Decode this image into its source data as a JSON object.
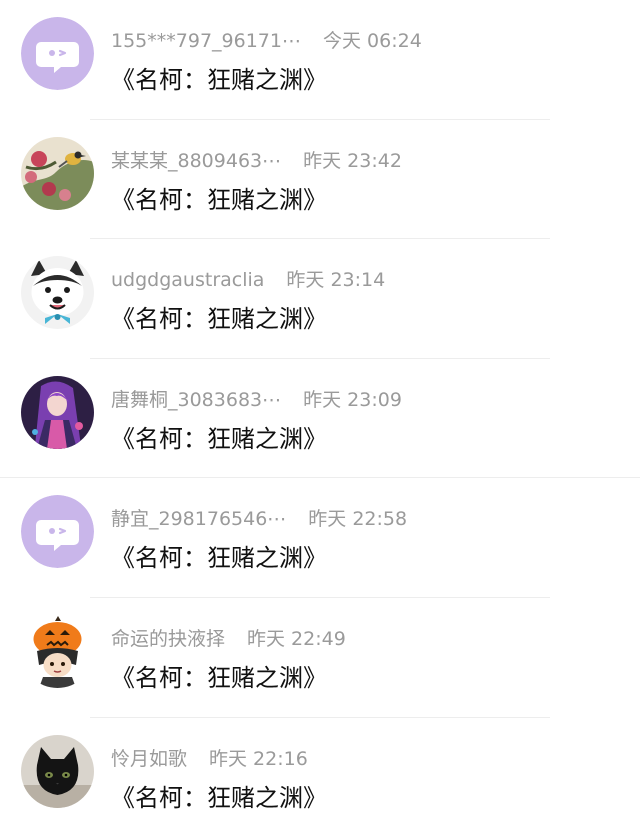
{
  "messages": [
    {
      "name": "155***797_96171⋯",
      "time": "今天 06:24",
      "text": "《名柯：狂赌之渊》",
      "avatar": "chat-bubble-icon"
    },
    {
      "name": "某某某_8809463⋯",
      "time": "昨天 23:42",
      "text": "《名柯：狂赌之渊》",
      "avatar": "bird-flower-painting"
    },
    {
      "name": "udgdgaustraclia",
      "time": "昨天 23:14",
      "text": "《名柯：狂赌之渊》",
      "avatar": "husky-dog-bowtie"
    },
    {
      "name": "唐舞桐_3083683⋯",
      "time": "昨天 23:09",
      "text": "《名柯：狂赌之渊》",
      "avatar": "anime-girl-purple"
    },
    {
      "name": "静宜_298176546⋯",
      "time": "昨天 22:58",
      "text": "《名柯：狂赌之渊》",
      "avatar": "chat-bubble-icon"
    },
    {
      "name": "命运的抉液择",
      "time": "昨天 22:49",
      "text": "《名柯：狂赌之渊》",
      "avatar": "pumpkin-hat-boy"
    },
    {
      "name": "怜月如歌",
      "time": "昨天 22:16",
      "text": "《名柯：狂赌之渊》",
      "avatar": "black-cat"
    }
  ],
  "colors": {
    "default_avatar_bg": "#c9b6ea",
    "meta_text": "#9a9a9a",
    "message_text": "#111111"
  }
}
